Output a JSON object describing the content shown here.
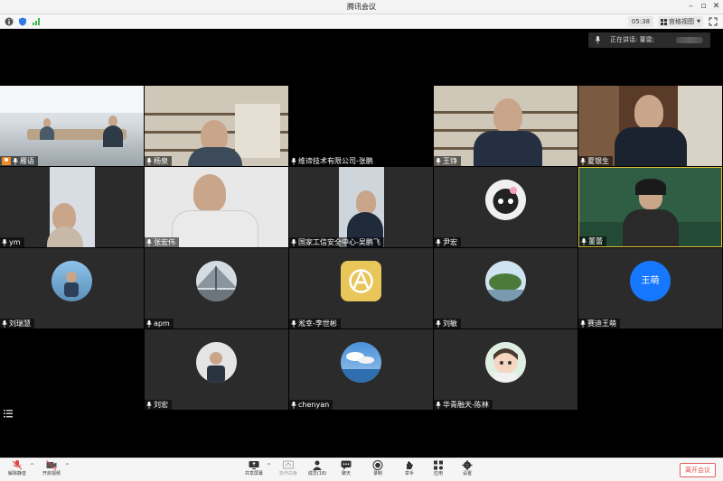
{
  "window": {
    "title": "腾讯会议"
  },
  "status": {
    "time": "05:38",
    "view_label": "宫格视图"
  },
  "speaking": {
    "label": "正在讲话: 董雷;"
  },
  "participants": [
    {
      "name": "雁语",
      "host": true
    },
    {
      "name": "杨泉"
    },
    {
      "name": "维谛技术有限公司-张鹏"
    },
    {
      "name": "王铮"
    },
    {
      "name": "夏银生"
    },
    {
      "name": "ym"
    },
    {
      "name": "张宏伟"
    },
    {
      "name": "国家工信安全中心-吴鹏飞"
    },
    {
      "name": "尹宏"
    },
    {
      "name": "董蕾"
    },
    {
      "name": "刘瑞慧"
    },
    {
      "name": "apm"
    },
    {
      "name": "淞幸-李世彬"
    },
    {
      "name": "刘敏"
    },
    {
      "name": "赛迪王萌",
      "avatar_text": "王萌"
    },
    {
      "name": "刘宏"
    },
    {
      "name": "chenyan"
    },
    {
      "name": "华青融天-陈林"
    }
  ],
  "toolbar": {
    "mute": "解除静音",
    "video": "开启视频",
    "share": "共享屏幕",
    "whiteboard": "协作白板",
    "members": "成员(18)",
    "chat": "聊天",
    "record": "录制",
    "raise_hand": "举手",
    "apps": "应用",
    "settings": "设置",
    "leave": "离开会议"
  },
  "colors": {
    "accent": "#1677ff",
    "leave": "#e05050",
    "host_badge": "#f08a24"
  }
}
